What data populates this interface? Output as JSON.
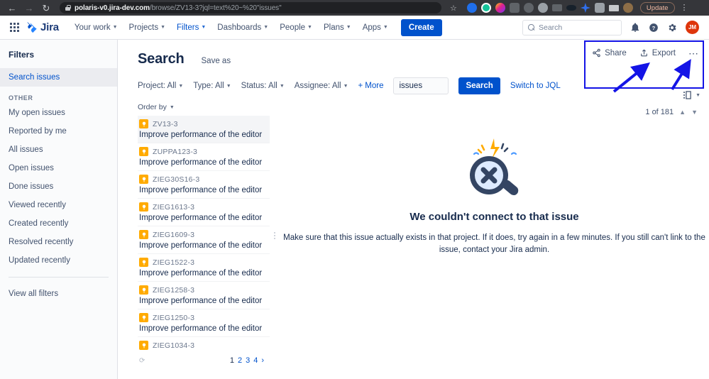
{
  "browser": {
    "back_icon": "arrow-left-icon",
    "forward_icon": "arrow-right-icon",
    "reload_icon": "reload-icon",
    "lock_icon": "lock-icon",
    "url_host": "polaris-v0.jira-dev.com",
    "url_path": "/browse/ZV13-3?jql=text%20~%20\"issues\"",
    "star_icon": "bookmark-star-icon",
    "update_label": "Update",
    "menu_icon": "browser-menu-icon",
    "extensions": [
      {
        "name": "extension-pocket",
        "color": "#1f6feb"
      },
      {
        "name": "extension-grammarly",
        "color": "#15c39a"
      },
      {
        "name": "extension-colorful",
        "color": "#e0218a"
      },
      {
        "name": "extension-camera",
        "color": "#5f6368"
      },
      {
        "name": "extension-check",
        "color": "#5f6368"
      },
      {
        "name": "extension-gray-circle",
        "color": "#9aa0a6"
      },
      {
        "name": "extension-battery",
        "color": "#5f6368"
      },
      {
        "name": "extension-saucer",
        "color": "#17212b"
      },
      {
        "name": "extension-sparkle",
        "color": "#2f6fed"
      },
      {
        "name": "extension-puzzle",
        "color": "#9aa0a6"
      },
      {
        "name": "extension-playlist",
        "color": "#c7c9cc"
      },
      {
        "name": "extension-profile-avatar",
        "color": "#8d6e47"
      }
    ]
  },
  "topnav": {
    "app_switcher_icon": "app-switcher-grid-icon",
    "logo_text": "Jira",
    "items": [
      {
        "label": "Your work",
        "active": false
      },
      {
        "label": "Projects",
        "active": false
      },
      {
        "label": "Filters",
        "active": true
      },
      {
        "label": "Dashboards",
        "active": false
      },
      {
        "label": "People",
        "active": false
      },
      {
        "label": "Plans",
        "active": false
      },
      {
        "label": "Apps",
        "active": false
      }
    ],
    "create_label": "Create",
    "search_placeholder": "Search",
    "notifications_icon": "bell-icon",
    "help_icon": "help-circle-icon",
    "settings_icon": "gear-icon",
    "avatar_initials": "JM",
    "avatar_color": "#de350b"
  },
  "sidebar": {
    "title": "Filters",
    "selected": "Search issues",
    "primary": [
      {
        "label": "Search issues",
        "selected": true
      }
    ],
    "group_label": "OTHER",
    "other": [
      {
        "label": "My open issues"
      },
      {
        "label": "Reported by me"
      },
      {
        "label": "All issues"
      },
      {
        "label": "Open issues"
      },
      {
        "label": "Done issues"
      },
      {
        "label": "Viewed recently"
      },
      {
        "label": "Created recently"
      },
      {
        "label": "Resolved recently"
      },
      {
        "label": "Updated recently"
      }
    ],
    "footer_link": "View all filters"
  },
  "main": {
    "page_title": "Search",
    "save_as_label": "Save as",
    "actions": {
      "share_label": "Share",
      "share_icon": "share-icon",
      "export_label": "Export",
      "export_icon": "export-upload-icon",
      "more_icon": "more-horizontal-icon",
      "highlight_color": "#1414e6"
    },
    "view_toggle_icon": "detail-view-layout-icon",
    "filters": [
      {
        "label": "Project: All"
      },
      {
        "label": "Type: All"
      },
      {
        "label": "Status: All"
      },
      {
        "label": "Assignee: All"
      }
    ],
    "more_filters_label": "More",
    "search_value": "issues",
    "search_button_label": "Search",
    "jql_link_label": "Switch to JQL",
    "order_by_label": "Order by",
    "counter": "1 of 181",
    "counter_up_icon": "chevron-up-icon",
    "counter_down_icon": "chevron-down-icon",
    "issue_type_icon": "idea-lightbulb-icon",
    "issues": [
      {
        "key": "ZV13-3",
        "summary": "Improve performance of the editor",
        "selected": true
      },
      {
        "key": "ZUPPA123-3",
        "summary": "Improve performance of the editor",
        "selected": false
      },
      {
        "key": "ZIEG30S16-3",
        "summary": "Improve performance of the editor",
        "selected": false
      },
      {
        "key": "ZIEG1613-3",
        "summary": "Improve performance of the editor",
        "selected": false
      },
      {
        "key": "ZIEG1609-3",
        "summary": "Improve performance of the editor",
        "selected": false
      },
      {
        "key": "ZIEG1522-3",
        "summary": "Improve performance of the editor",
        "selected": false
      },
      {
        "key": "ZIEG1258-3",
        "summary": "Improve performance of the editor",
        "selected": false
      },
      {
        "key": "ZIEG1250-3",
        "summary": "Improve performance of the editor",
        "selected": false
      },
      {
        "key": "ZIEG1034-3",
        "summary": "",
        "selected": false
      }
    ],
    "pagination": {
      "refresh_icon": "refresh-spinner-icon",
      "pages": [
        {
          "label": "1",
          "current": true
        },
        {
          "label": "2",
          "current": false
        },
        {
          "label": "3",
          "current": false
        },
        {
          "label": "4",
          "current": false
        }
      ],
      "next_label": "›"
    },
    "error": {
      "illustration": "broken-magnifier-icon",
      "title": "We couldn't connect to that issue",
      "body": "Make sure that this issue actually exists in that project. If it does, try again in a few minutes. If you still can't link to the issue, contact your Jira admin."
    }
  }
}
